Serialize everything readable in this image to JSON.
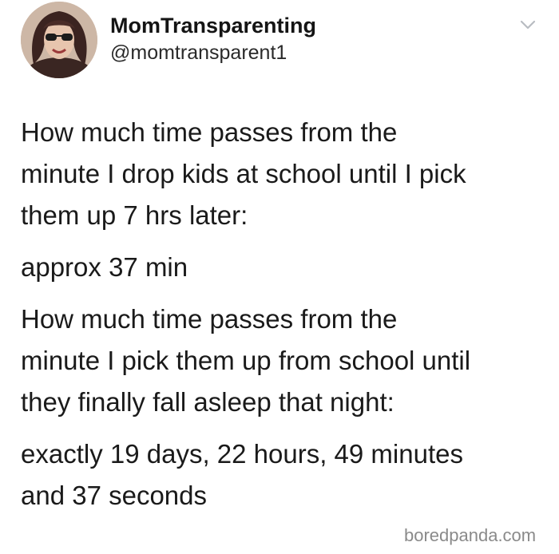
{
  "tweet": {
    "author": {
      "display_name": "MomTransparenting",
      "handle": "@momtransparent1"
    },
    "menu_icon": "chevron-down-icon",
    "paragraphs": [
      {
        "lines": [
          "How much time passes from the",
          "minute I drop kids at school until I pick",
          "them up 7 hrs later:"
        ]
      },
      {
        "lines": [
          "approx 37 min"
        ]
      },
      {
        "lines": [
          "How much time passes from the",
          "minute I pick them up from school until",
          "they finally fall asleep that night:"
        ]
      },
      {
        "lines": [
          "exactly 19 days, 22 hours, 49 minutes",
          "and 37 seconds"
        ]
      }
    ]
  },
  "watermark": {
    "text": "boredpanda.com"
  },
  "colors": {
    "text": "#1a1a1a",
    "chevron": "#b8bcc2",
    "watermark": "#8a8a8a",
    "background": "#ffffff"
  }
}
